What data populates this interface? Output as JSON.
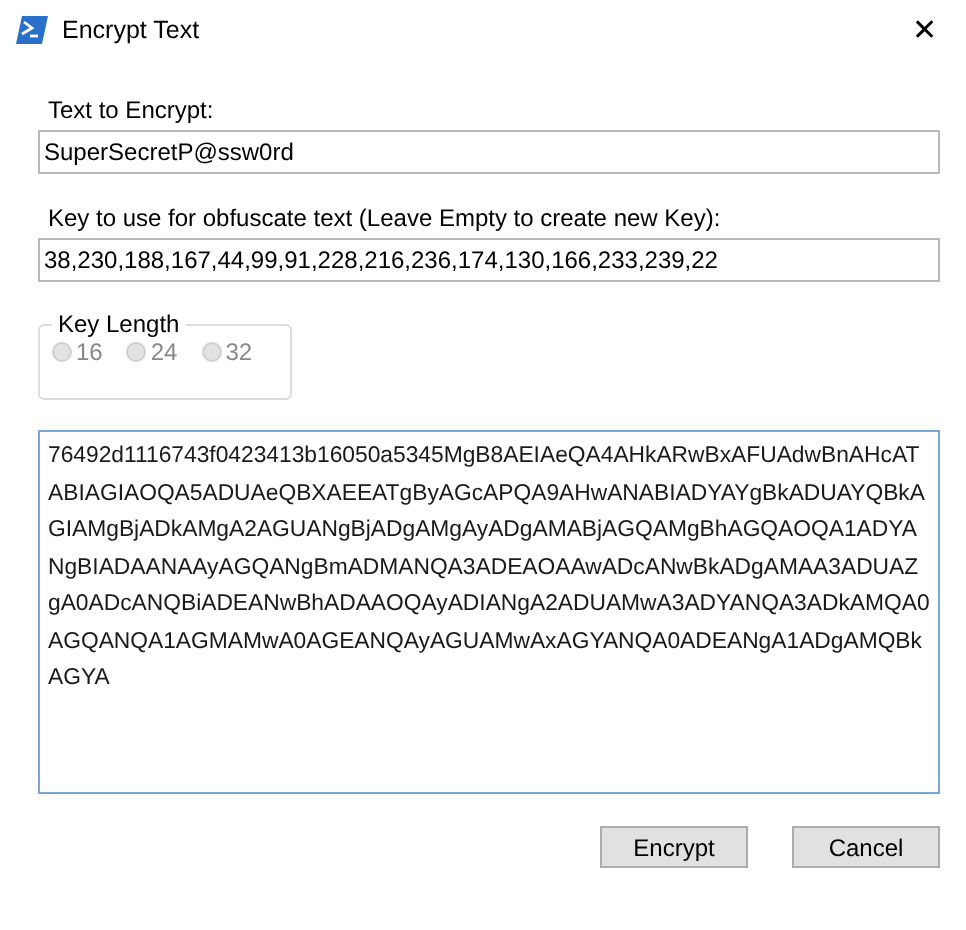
{
  "window": {
    "title": "Encrypt Text",
    "close": "✕"
  },
  "text_field": {
    "label": "Text to Encrypt:",
    "value": "SuperSecretP@ssw0rd"
  },
  "key_field": {
    "label": "Key to use for obfuscate text (Leave Empty to create new Key):",
    "value": "38,230,188,167,44,99,91,228,216,236,174,130,166,233,239,22"
  },
  "key_length": {
    "title": "Key Length",
    "options": [
      {
        "label": "16",
        "selected": false
      },
      {
        "label": "24",
        "selected": false
      },
      {
        "label": "32",
        "selected": false
      }
    ]
  },
  "output": {
    "value": "76492d1116743f0423413b16050a5345MgB8AEIAeQA4AHkARwBxAFUAdwBnAHcATABIAGIAOQA5ADUAeQBXAEEATgByAGcAPQA9AHwANABIADYAYgBkADUAYQBkAGIAMgBjADkAMgA2AGUANgBjADgAMgAyADgAMABjAGQAMgBhAGQAOQA1ADYANgBIADAANAAyAGQANgBmADMANQA3ADEAOAAwADcANwBkADgAMAA3ADUAZgA0ADcANQBiADEANwBhADAAOQAyADIANgA2ADUAMwA3ADYANQA3ADkAMQA0AGQANQA1AGMAMwA0AGEANQAyAGUAMwAxAGYANQA0ADEANgA1ADgAMQBkAGYA"
  },
  "buttons": [
    "Encrypt",
    "Cancel"
  ]
}
